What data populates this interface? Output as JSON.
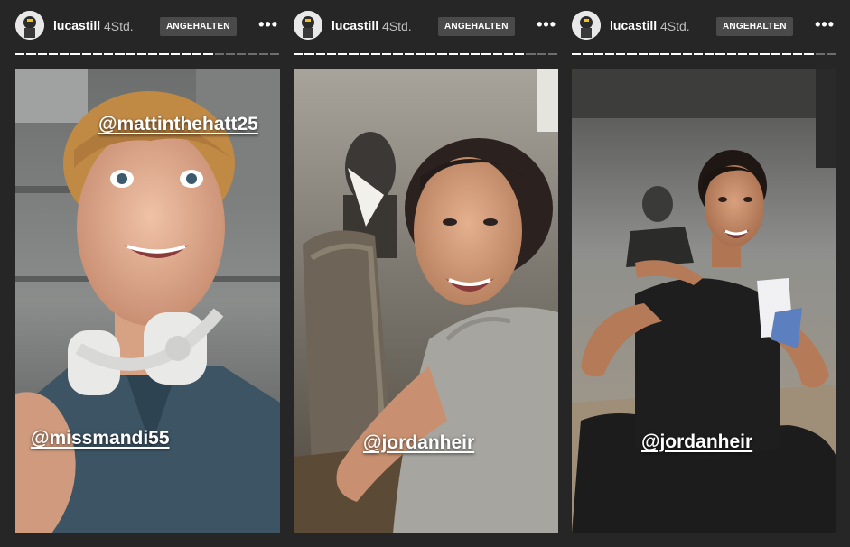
{
  "stories": [
    {
      "username": "lucastill",
      "time": "4Std.",
      "badge": "ANGEHALTEN",
      "more": "•••",
      "mentions": [
        "@mattinthehatt25",
        "@missmandi55"
      ]
    },
    {
      "username": "lucastill",
      "time": "4Std.",
      "badge": "ANGEHALTEN",
      "more": "•••",
      "mentions": [
        "@jordanheir"
      ]
    },
    {
      "username": "lucastill",
      "time": "4Std.",
      "badge": "ANGEHALTEN",
      "more": "•••",
      "mentions": [
        "@jordanheir"
      ]
    }
  ],
  "colors": {
    "background": "#262626",
    "badge": "#4a4a4a",
    "progress_done": "#ffffff",
    "progress_pending": "#6e6e6e"
  }
}
